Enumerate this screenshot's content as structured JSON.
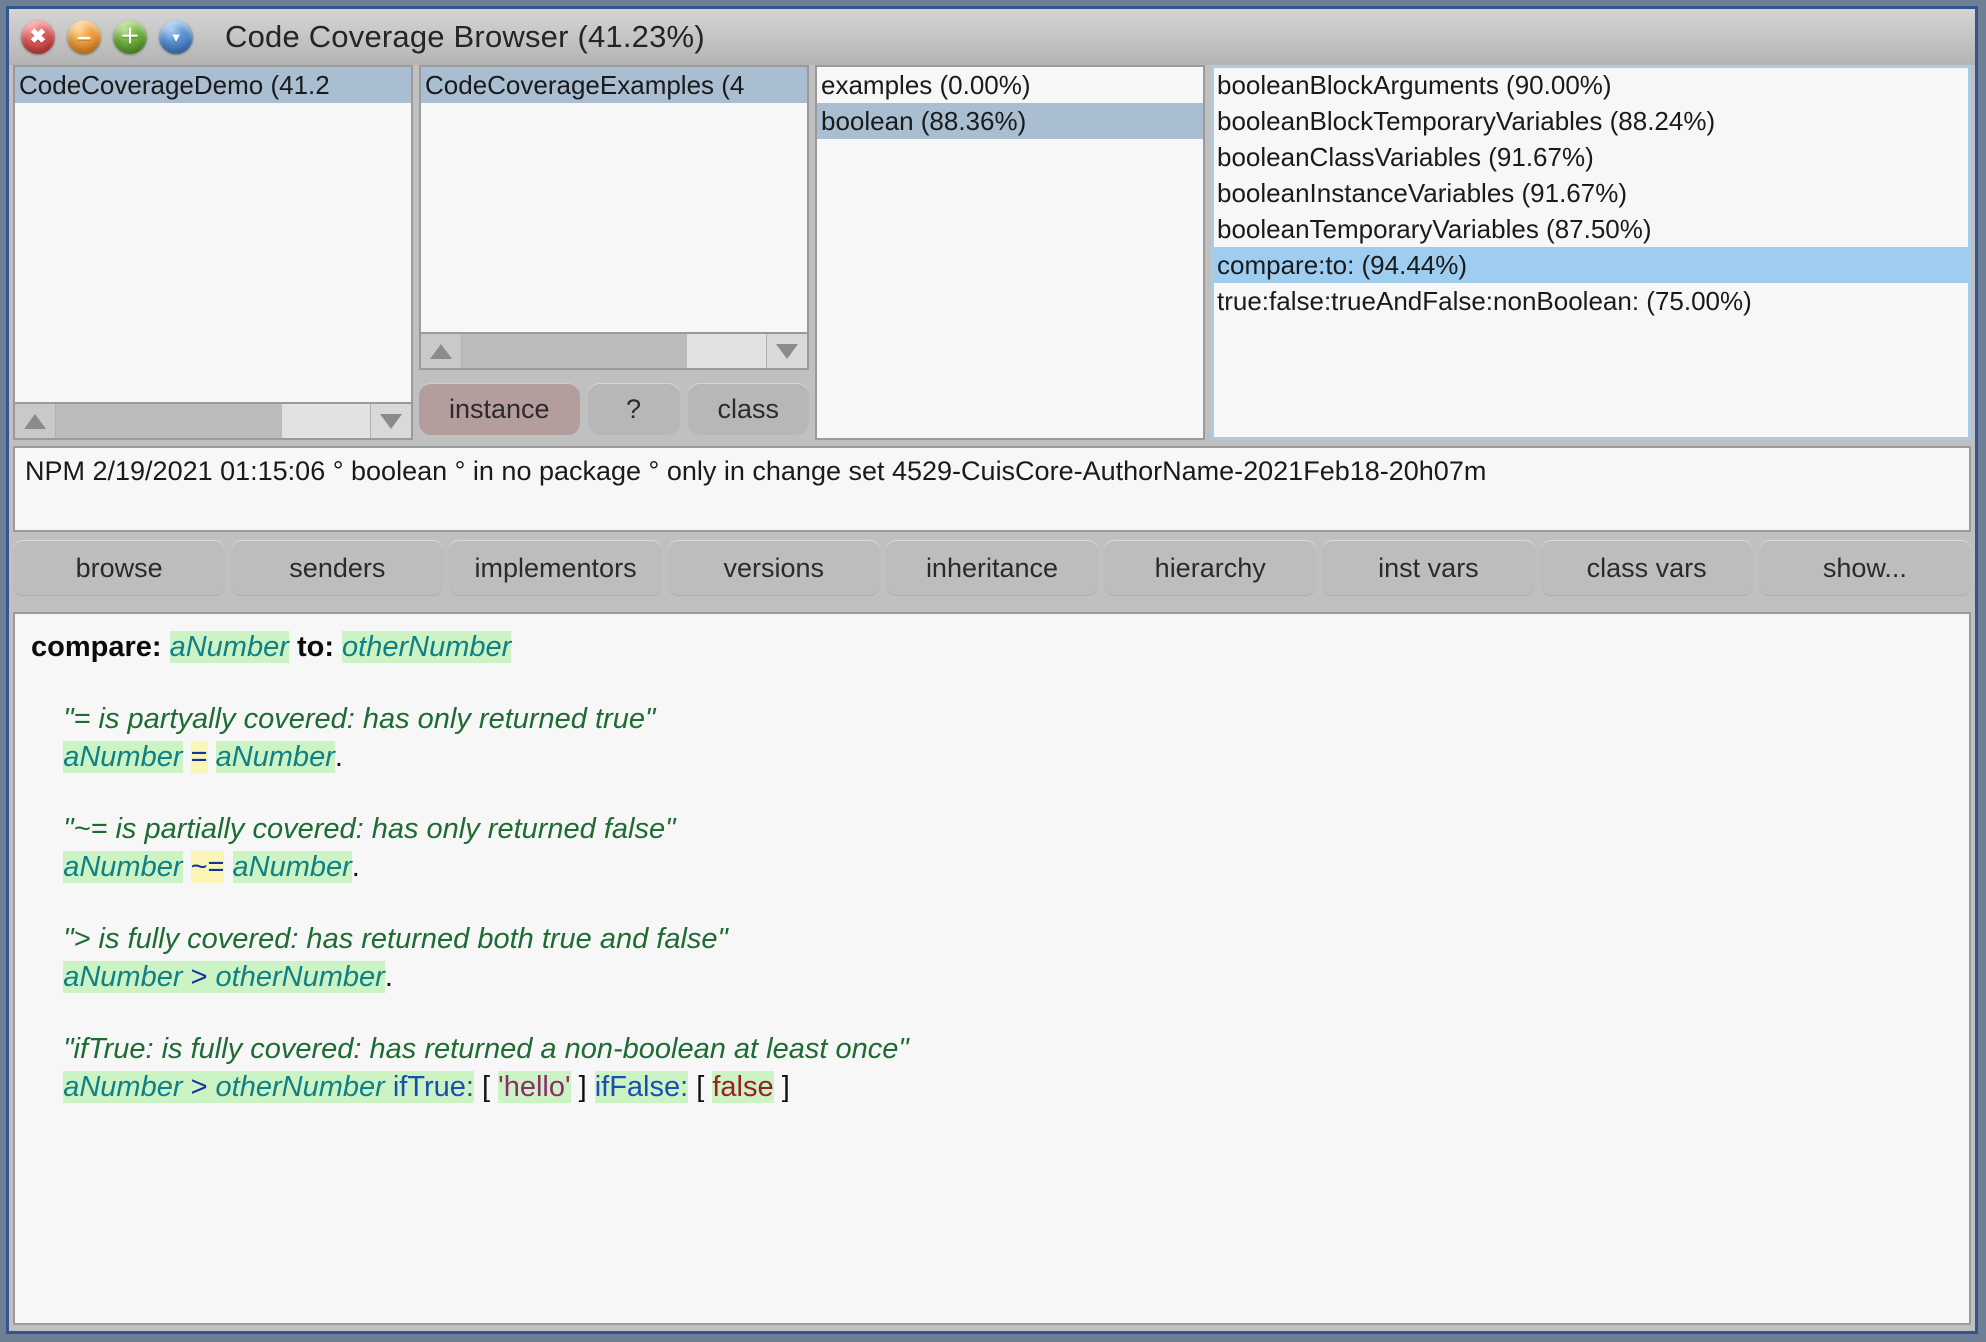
{
  "window": {
    "title": "Code Coverage Browser (41.23%)",
    "buttons": [
      {
        "name": "close",
        "icon": "close-icon",
        "glyph": "✖"
      },
      {
        "name": "minimize",
        "icon": "minimize-icon",
        "glyph": "–"
      },
      {
        "name": "maximize",
        "icon": "maximize-icon",
        "glyph": "＋"
      },
      {
        "name": "menu",
        "icon": "chevron-down-icon",
        "glyph": "▼"
      }
    ]
  },
  "panes": {
    "systemCategories": {
      "items": [
        {
          "label": "CodeCoverageDemo (41.2",
          "selected": true
        }
      ]
    },
    "classes": {
      "items": [
        {
          "label": "CodeCoverageExamples (4",
          "selected": true
        }
      ]
    },
    "messageCategories": {
      "items": [
        {
          "label": "examples (0.00%)",
          "selected": false
        },
        {
          "label": "boolean (88.36%)",
          "selected": true
        }
      ]
    },
    "methods": {
      "items": [
        {
          "label": "booleanBlockArguments (90.00%)",
          "selected": false
        },
        {
          "label": "booleanBlockTemporaryVariables (88.24%)",
          "selected": false
        },
        {
          "label": "booleanClassVariables (91.67%)",
          "selected": false
        },
        {
          "label": "booleanInstanceVariables (91.67%)",
          "selected": false
        },
        {
          "label": "booleanTemporaryVariables (87.50%)",
          "selected": false
        },
        {
          "label": "compare:to: (94.44%)",
          "selected": true
        },
        {
          "label": "true:false:trueAndFalse:nonBoolean: (75.00%)",
          "selected": false
        }
      ]
    }
  },
  "sideToggle": {
    "instance_label": "instance",
    "question_label": "?",
    "class_label": "class",
    "selected": "instance"
  },
  "status": {
    "text": "NPM 2/19/2021 01:15:06 ° boolean ° in no package ° only in change set 4529-CuisCore-AuthorName-2021Feb18-20h07m"
  },
  "toolbar": {
    "buttons": [
      "browse",
      "senders",
      "implementors",
      "versions",
      "inheritance",
      "hierarchy",
      "inst vars",
      "class vars",
      "show..."
    ]
  },
  "code": {
    "lines": [
      {
        "indent": 0,
        "tokens": [
          {
            "t": "compare:",
            "c": "kw"
          },
          {
            "t": " ",
            "c": "plain"
          },
          {
            "t": "aNumber",
            "c": "arg cov"
          },
          {
            "t": " ",
            "c": "plain"
          },
          {
            "t": "to:",
            "c": "kw"
          },
          {
            "t": " ",
            "c": "plain"
          },
          {
            "t": "otherNumber",
            "c": "arg cov"
          }
        ]
      },
      {
        "indent": 0,
        "tokens": [],
        "blank": true
      },
      {
        "indent": 1,
        "tokens": [
          {
            "t": "\"= is partyally covered: has only returned true\"",
            "c": "comment"
          }
        ]
      },
      {
        "indent": 1,
        "tokens": [
          {
            "t": "aNumber",
            "c": "arg cov"
          },
          {
            "t": " ",
            "c": "plain"
          },
          {
            "t": "=",
            "c": "op-blue part"
          },
          {
            "t": " ",
            "c": "plain"
          },
          {
            "t": "aNumber",
            "c": "arg cov"
          },
          {
            "t": ".",
            "c": "plain"
          }
        ]
      },
      {
        "indent": 0,
        "tokens": [],
        "blank": true
      },
      {
        "indent": 1,
        "tokens": [
          {
            "t": "\"~= is partially covered: has only returned false\"",
            "c": "comment"
          }
        ]
      },
      {
        "indent": 1,
        "tokens": [
          {
            "t": "aNumber",
            "c": "arg cov"
          },
          {
            "t": " ",
            "c": "plain"
          },
          {
            "t": "~=",
            "c": "op-blue part"
          },
          {
            "t": " ",
            "c": "plain"
          },
          {
            "t": "aNumber",
            "c": "arg cov"
          },
          {
            "t": ".",
            "c": "plain"
          }
        ]
      },
      {
        "indent": 0,
        "tokens": [],
        "blank": true
      },
      {
        "indent": 1,
        "tokens": [
          {
            "t": "\"> is fully covered: has returned both true and false\"",
            "c": "comment"
          }
        ]
      },
      {
        "indent": 1,
        "tokens": [
          {
            "t": "aNumber ",
            "c": "arg cov"
          },
          {
            "t": ">",
            "c": "op-blue cov"
          },
          {
            "t": " otherNumber",
            "c": "arg cov"
          },
          {
            "t": ".",
            "c": "plain"
          }
        ]
      },
      {
        "indent": 0,
        "tokens": [],
        "blank": true
      },
      {
        "indent": 1,
        "tokens": [
          {
            "t": "\"ifTrue: is fully covered: has returned a non-boolean at least once\"",
            "c": "comment"
          }
        ]
      },
      {
        "indent": 1,
        "tokens": [
          {
            "t": "aNumber ",
            "c": "arg cov"
          },
          {
            "t": ">",
            "c": "op-blue cov"
          },
          {
            "t": " otherNumber ",
            "c": "arg cov"
          },
          {
            "t": "ifTrue:",
            "c": "sel-blue cov"
          },
          {
            "t": " ",
            "c": "plain"
          },
          {
            "t": "[",
            "c": "bracket"
          },
          {
            "t": " ",
            "c": "plain"
          },
          {
            "t": "'hello'",
            "c": "str cov"
          },
          {
            "t": " ",
            "c": "plain"
          },
          {
            "t": "]",
            "c": "bracket"
          },
          {
            "t": " ",
            "c": "plain"
          },
          {
            "t": "ifFalse:",
            "c": "sel-blue cov"
          },
          {
            "t": " ",
            "c": "plain"
          },
          {
            "t": "[",
            "c": "bracket"
          },
          {
            "t": " ",
            "c": "plain"
          },
          {
            "t": "false",
            "c": "lit-red cov"
          },
          {
            "t": " ",
            "c": "plain"
          },
          {
            "t": "]",
            "c": "bracket"
          }
        ]
      }
    ]
  }
}
